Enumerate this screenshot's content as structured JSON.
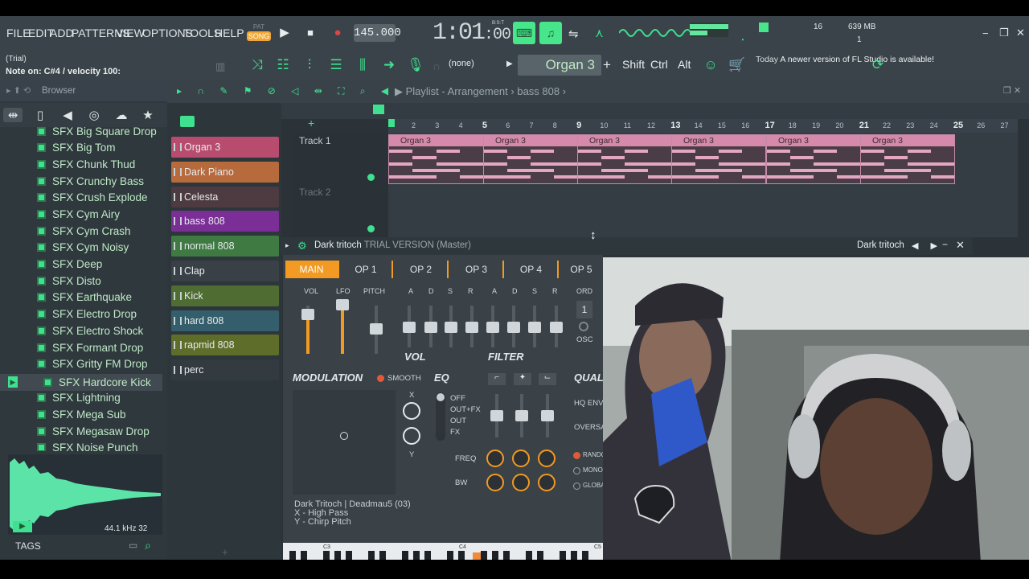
{
  "menu": [
    "FILE",
    "EDIT",
    "ADD",
    "PATTERNS",
    "VIEW",
    "OPTIONS",
    "TOOLS",
    "HELP"
  ],
  "transport": {
    "pat": "PAT",
    "song": "SONG",
    "play": "▶",
    "stop": "■",
    "record": "●",
    "tempo": "145.000",
    "time_main": "1:01",
    "time_small": ":00",
    "bst": "B:S:T"
  },
  "status": {
    "cpu": "16",
    "memory": "639 MB",
    "voices": "1"
  },
  "hint": {
    "line1": "(Trial)",
    "line2": "Note on: C#4 / velocity 100:"
  },
  "toolbar": {
    "none": "(none)",
    "instrument": "Organ 3",
    "shift": "Shift",
    "ctrl": "Ctrl",
    "alt": "Alt"
  },
  "news": {
    "today": "Today",
    "message": "A newer version of FL Studio is available!"
  },
  "browser": {
    "title": "Browser",
    "items": [
      "SFX Big Square Drop",
      "SFX Big Tom",
      "SFX Chunk Thud",
      "SFX Crunchy Bass",
      "SFX Crush Explode",
      "SFX Cym Airy",
      "SFX Cym Crash",
      "SFX Cym Noisy",
      "SFX Deep",
      "SFX Disto",
      "SFX Earthquake",
      "SFX Electro Drop",
      "SFX Electro Shock",
      "SFX Formant Drop",
      "SFX Gritty FM Drop",
      "SFX Hardcore Kick",
      "SFX Lightning",
      "SFX Mega Sub",
      "SFX Megasaw Drop",
      "SFX Noise Punch"
    ],
    "selected_index": 15,
    "sample_rate": "44.1 kHz",
    "bits": "32",
    "tags": "TAGS"
  },
  "picker": [
    {
      "label": "Organ 3",
      "color": "#b84c6f"
    },
    {
      "label": "Dark Piano",
      "color": "#b76a3c"
    },
    {
      "label": "Celesta",
      "color": "#4d3b41"
    },
    {
      "label": "bass 808",
      "color": "#7a2e96"
    },
    {
      "label": "normal 808",
      "color": "#3f7a43"
    },
    {
      "label": "Clap",
      "color": "#3a4146"
    },
    {
      "label": "Kick",
      "color": "#4f6d33"
    },
    {
      "label": "hard 808",
      "color": "#345e6b"
    },
    {
      "label": "rapmid 808",
      "color": "#5f6d2a"
    },
    {
      "label": "perc",
      "color": "#343b40"
    }
  ],
  "playlist": {
    "title": "Playlist - Arrangement",
    "pattern": "bass 808",
    "ruler": [
      "2",
      "3",
      "4",
      "5",
      "6",
      "7",
      "8",
      "9",
      "10",
      "11",
      "12",
      "13",
      "14",
      "15",
      "16",
      "17",
      "18",
      "19",
      "20",
      "21",
      "22",
      "23",
      "24",
      "25",
      "26",
      "27"
    ],
    "tracks": [
      "Track 1",
      "Track 2"
    ],
    "clips": [
      "Organ 3",
      "Organ 3",
      "Organ 3",
      "Organ 3",
      "Organ 3",
      "Organ 3"
    ]
  },
  "plugin": {
    "name": "Dark tritoch",
    "subtitle": "TRIAL VERSION (Master)",
    "tabs": [
      "MAIN",
      "OP 1",
      "OP 2",
      "OP 3",
      "OP 4",
      "OP 5"
    ],
    "main_labels": [
      "VOL",
      "LFO",
      "PITCH"
    ],
    "env_labels": [
      "A",
      "D",
      "S",
      "R"
    ],
    "vol": "VOL",
    "filter": "FILTER",
    "ord": "ORD",
    "ord_value": "1",
    "osc": "OSC",
    "modulation": "MODULATION",
    "smooth": "SMOOTH",
    "x": "X",
    "y": "Y",
    "eq": "EQ",
    "eq_opts": [
      "OFF",
      "OUT+FX",
      "OUT",
      "FX"
    ],
    "freq": "FREQ",
    "bw": "BW",
    "quality": "QUALITY",
    "quality_opts": [
      "HQ ENVE",
      "OVERSAL"
    ],
    "radio_opts": [
      "RANDO",
      "MONO",
      "GLOBA"
    ],
    "patch_lines": [
      "Dark Tritoch    | Deadmau5 (03)",
      "X - High Pass",
      "Y - Chirp Pitch"
    ],
    "keys": [
      "C3",
      "C4",
      "C5"
    ]
  },
  "colors": {
    "accent": "#3fe090",
    "orange": "#f29a21",
    "clip": "#d68aab"
  }
}
